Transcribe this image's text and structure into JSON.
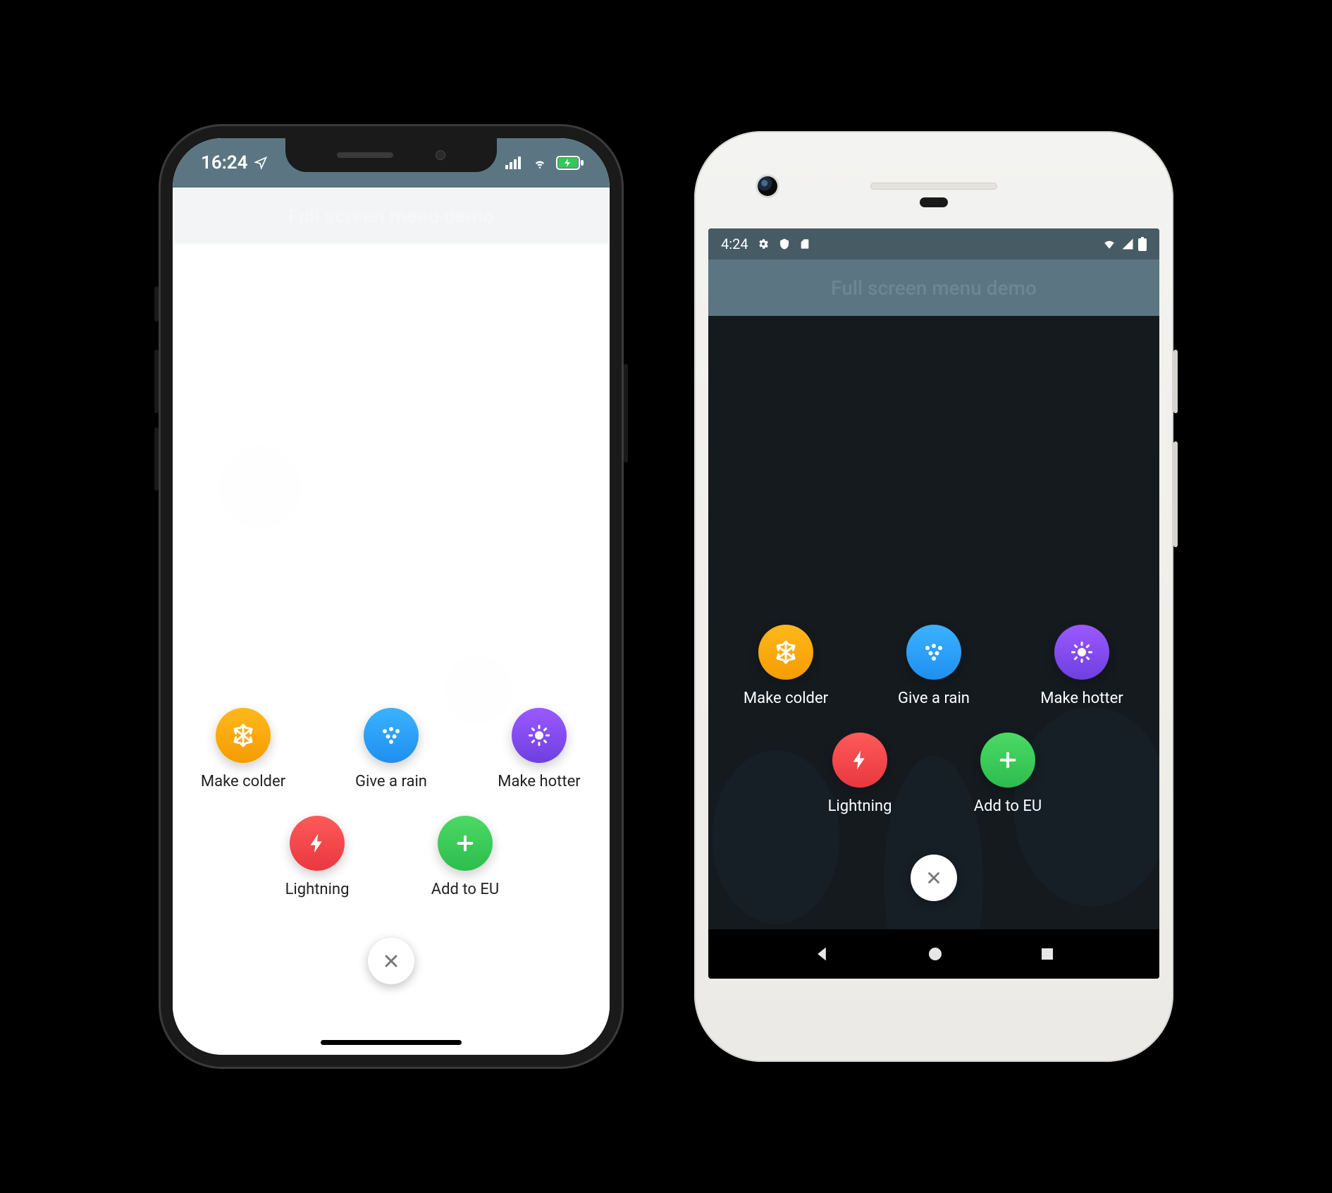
{
  "app_title": "Full screen menu demo",
  "ios": {
    "time": "16:24"
  },
  "android": {
    "time": "4:24"
  },
  "menu": {
    "row1": [
      {
        "label": "Make colder",
        "icon": "snowflake",
        "color_top": "#ffb81c",
        "color_bot": "#f59c00"
      },
      {
        "label": "Give a rain",
        "icon": "rain",
        "color_top": "#3bb2ff",
        "color_bot": "#1f8ff0"
      },
      {
        "label": "Make hotter",
        "icon": "sun",
        "color_top": "#9b59ff",
        "color_bot": "#6f3fe0"
      }
    ],
    "row2": [
      {
        "label": "Lightning",
        "icon": "bolt",
        "color_top": "#ff5a5a",
        "color_bot": "#e8383f"
      },
      {
        "label": "Add to EU",
        "icon": "plus",
        "color_top": "#4cd964",
        "color_bot": "#2dbd4e"
      }
    ],
    "close_icon": "close"
  },
  "android_nav": {
    "back": "back",
    "home": "home",
    "recent": "recent"
  }
}
